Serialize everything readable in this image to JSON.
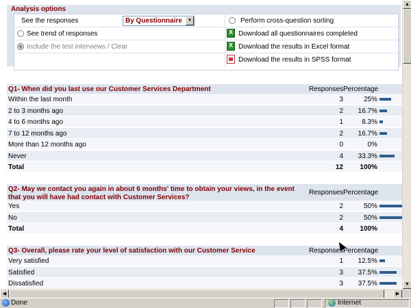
{
  "options": {
    "title": "Analysis options",
    "see_responses_label": "See the responses",
    "select_value": "By Questionnaire",
    "perform_sorting": "Perform cross-question sorting",
    "see_trend": "See trend of responses",
    "download_all": "Download all questionnaires completed",
    "include_test": "Include the test interviews / Clear",
    "download_excel": "Download the results in Excel format",
    "download_spss": "Download the results in SPSS format"
  },
  "headers": {
    "responses": "Responses",
    "percentage": "Percentage"
  },
  "questions": [
    {
      "title_lines": [
        "Q1- When did you last use our Customer Services Department"
      ],
      "rows": [
        {
          "label": "Within the last month",
          "responses": "3",
          "pct": "25%",
          "value": 25
        },
        {
          "label": "2 to 3 months ago",
          "responses": "2",
          "pct": "16.7%",
          "value": 16.7
        },
        {
          "label": "4 to 6 months ago",
          "responses": "1",
          "pct": "8.3%",
          "value": 8.3
        },
        {
          "label": "7 to 12 months ago",
          "responses": "2",
          "pct": "16.7%",
          "value": 16.7
        },
        {
          "label": "More than 12 months ago",
          "responses": "0",
          "pct": "0%",
          "value": 0
        },
        {
          "label": "Never",
          "responses": "4",
          "pct": "33.3%",
          "value": 33.3
        }
      ],
      "total": {
        "label": "Total",
        "responses": "12",
        "pct": "100%"
      }
    },
    {
      "title_lines": [
        "Q2- May we contact you again in about 6 months' time to obtain your views, in the event",
        "that you will have had contact with Customer Services?"
      ],
      "rows": [
        {
          "label": "Yes",
          "responses": "2",
          "pct": "50%",
          "value": 50
        },
        {
          "label": "No",
          "responses": "2",
          "pct": "50%",
          "value": 50
        }
      ],
      "total": {
        "label": "Total",
        "responses": "4",
        "pct": "100%"
      }
    },
    {
      "title_lines": [
        "Q3- Overall, please rate your level of satisfaction with our Customer Service"
      ],
      "rows": [
        {
          "label": "Very satisfied",
          "responses": "1",
          "pct": "12.5%",
          "value": 12.5
        },
        {
          "label": "Satisfied",
          "responses": "3",
          "pct": "37.5%",
          "value": 37.5
        },
        {
          "label": "Dissatisfied",
          "responses": "3",
          "pct": "37.5%",
          "value": 37.5
        }
      ],
      "total": null
    }
  ],
  "statusbar": {
    "status": "Done",
    "zone": "Internet"
  },
  "colors": {
    "heading": "#800000",
    "bar": "#2f5c8f",
    "panel": "#dde4ee"
  }
}
